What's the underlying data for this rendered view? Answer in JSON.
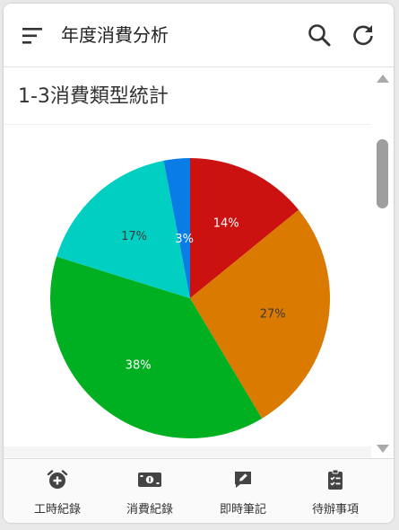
{
  "appbar": {
    "title": "年度消費分析",
    "menu_icon": "menu-icon",
    "search_icon": "search-icon",
    "refresh_icon": "refresh-icon"
  },
  "card": {
    "title": "1-3消費類型統計"
  },
  "chart_data": {
    "type": "pie",
    "title": "1-3消費類型統計",
    "slices": [
      {
        "value": 14,
        "label": "14%",
        "color": "#cc1111",
        "label_color": "#ffffff"
      },
      {
        "value": 27,
        "label": "27%",
        "color": "#db7a00",
        "label_color": "#3a3a3a"
      },
      {
        "value": 38,
        "label": "38%",
        "color": "#00b020",
        "label_color": "#ffffff"
      },
      {
        "value": 17,
        "label": "17%",
        "color": "#00cfc2",
        "label_color": "#3a3a3a"
      },
      {
        "value": 3,
        "label": "3%",
        "color": "#0a7ce6",
        "label_color": "#ffffff"
      }
    ]
  },
  "bottom_nav": [
    {
      "label": "工時紀錄",
      "icon": "alarm-add-icon"
    },
    {
      "label": "消費紀錄",
      "icon": "money-icon"
    },
    {
      "label": "即時筆記",
      "icon": "note-edit-icon"
    },
    {
      "label": "待辦事項",
      "icon": "checklist-icon"
    }
  ],
  "colors": {
    "accent": "#333333",
    "scroll_thumb": "#9e9e9e"
  }
}
